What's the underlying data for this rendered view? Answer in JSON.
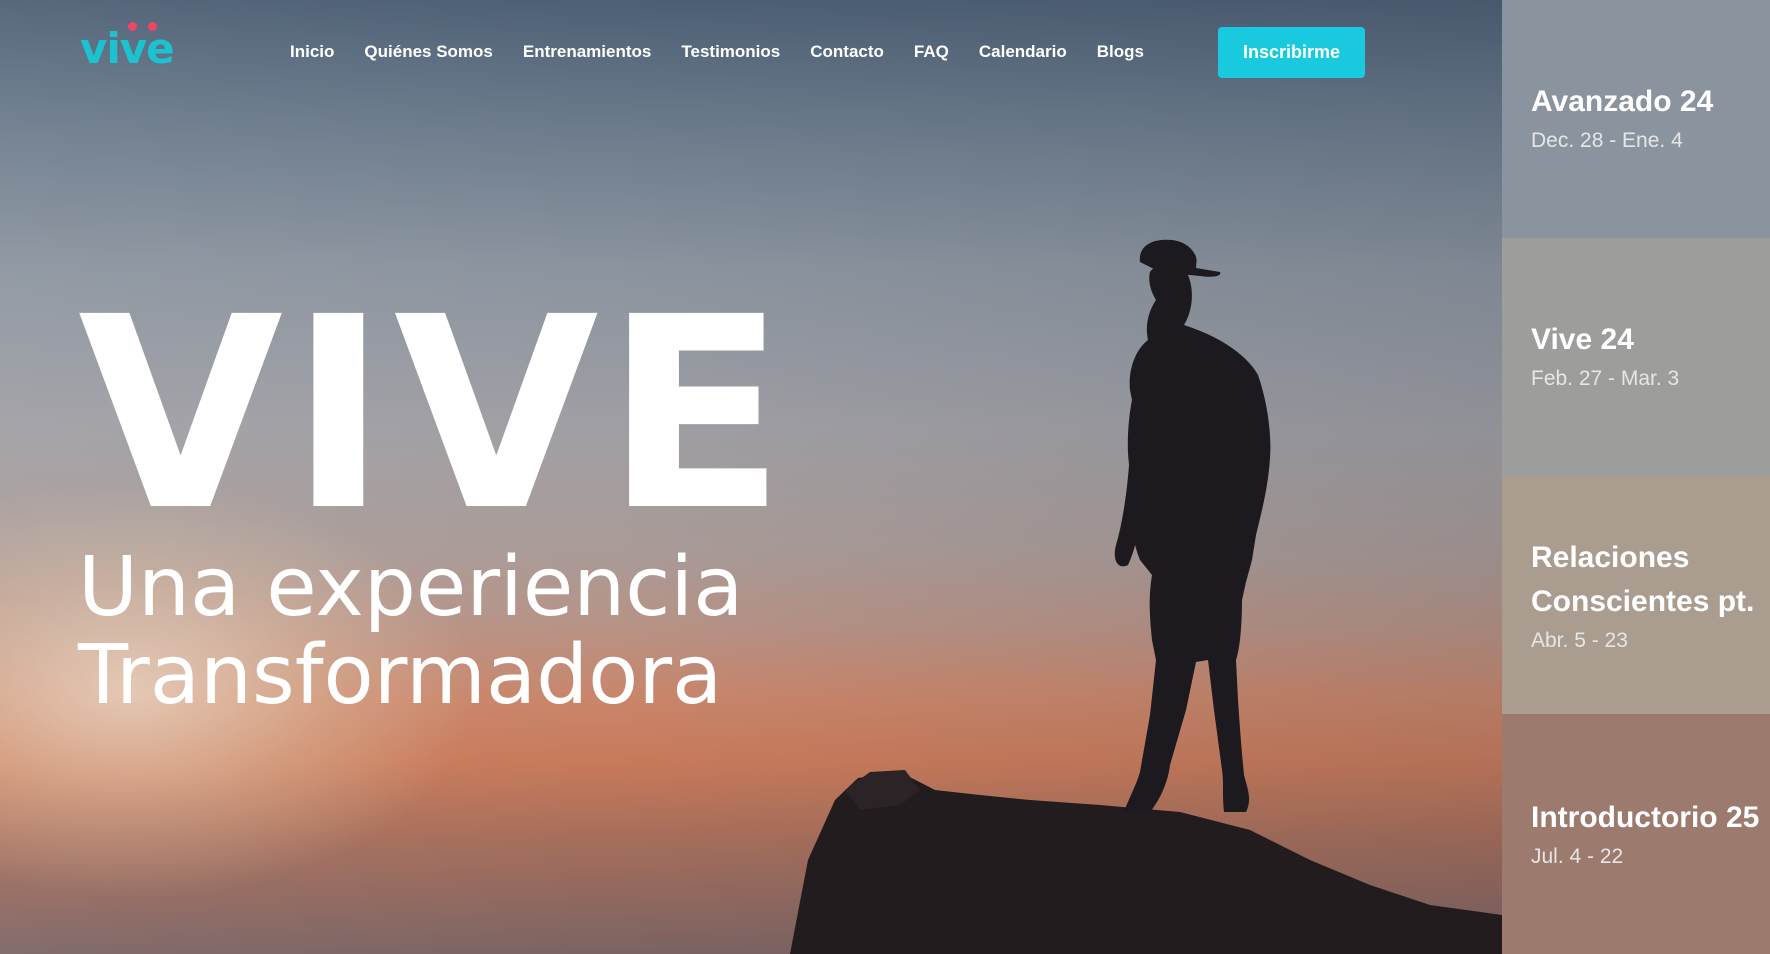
{
  "brand": {
    "logo_text": "vive",
    "logo_color": "#1bc2d0",
    "logo_dot_color": "#ef4566"
  },
  "nav": {
    "items": [
      {
        "label": "Inicio"
      },
      {
        "label": "Quiénes Somos"
      },
      {
        "label": "Entrenamientos"
      },
      {
        "label": "Testimonios"
      },
      {
        "label": "Contacto"
      },
      {
        "label": "FAQ"
      },
      {
        "label": "Calendario"
      },
      {
        "label": "Blogs"
      }
    ],
    "cta_label": "Inscribirme",
    "cta_color": "#19c9dd"
  },
  "hero": {
    "title": "VIVE",
    "subtitle_line1": "Una experiencia",
    "subtitle_line2": "Transformadora"
  },
  "events": [
    {
      "title": "Avanzado 24",
      "date": "Dec. 28 - Ene. 4",
      "color": "#8a949e"
    },
    {
      "title": "Vive 24",
      "date": "Feb. 27 - Mar. 3",
      "color": "#9d9d9c"
    },
    {
      "title_line1": "Relaciones",
      "title_line2": "Conscientes pt.",
      "date": "Abr. 5 - 23",
      "color": "#ab9c90"
    },
    {
      "title": "Introductorio 25",
      "date": "Jul. 4 - 22",
      "color": "#9d7a6e"
    }
  ]
}
